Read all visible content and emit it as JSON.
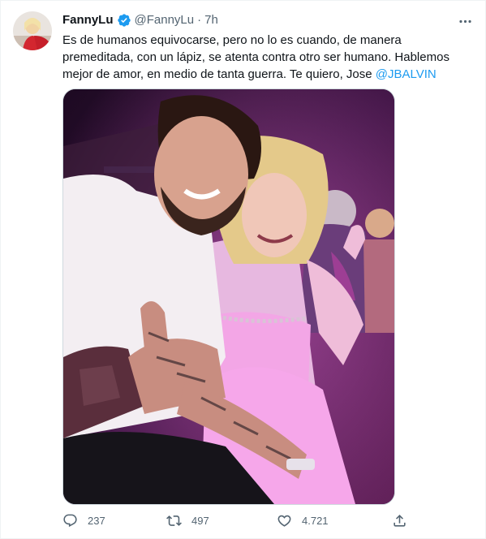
{
  "author": {
    "display_name": "FannyLu",
    "handle": "@FannyLu",
    "separator": "·",
    "time": "7h",
    "verified": true
  },
  "tweet": {
    "text_main": "Es de humanos equivocarse, pero no lo es cuando, de manera premeditada, con un lápiz, se atenta contra otro ser humano. Hablemos mejor de amor, en medio de tanta guerra. Te quiero, Jose ",
    "mention": "@JBALVIN"
  },
  "actions": {
    "replies": "237",
    "retweets": "497",
    "likes": "4.721"
  },
  "colors": {
    "accent": "#1d9bf0",
    "muted": "#536471",
    "text": "#0f1419",
    "border": "#cfd9de"
  },
  "icons": [
    "verified-badge-icon",
    "more-options-icon",
    "reply-icon",
    "retweet-icon",
    "like-icon",
    "share-icon"
  ]
}
